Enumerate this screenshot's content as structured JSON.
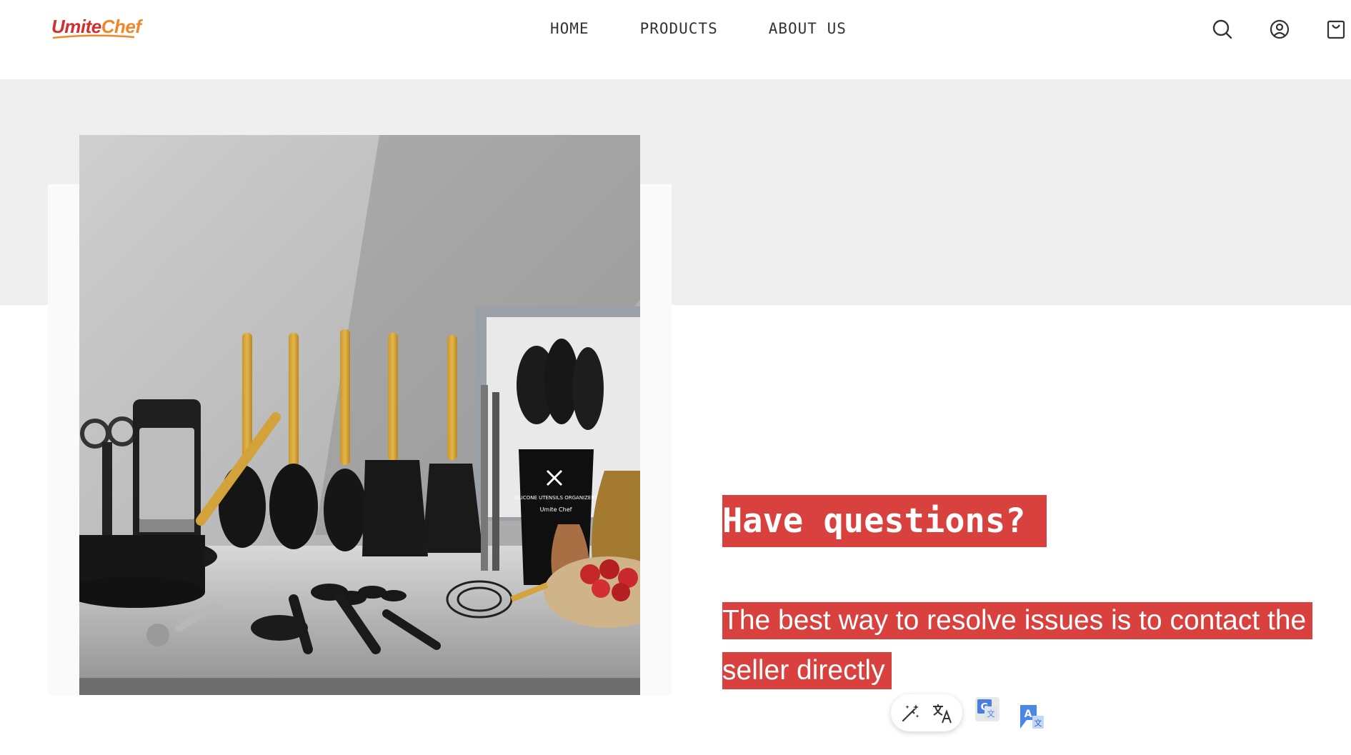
{
  "brand": {
    "logo_part1": "Umite",
    "logo_part2": "Chef"
  },
  "nav": {
    "home": "HOME",
    "products": "PRODUCTS",
    "about": "ABOUT US"
  },
  "hero": {
    "headline": "Have questions?",
    "subtext": "The best way to resolve issues is to contact the seller directly",
    "image_alt": "Black silicone kitchen utensils with wooden handles, holder labeled Silicone Utensils Organizers, grater and measuring cups on a marble countertop"
  },
  "product_label": {
    "line1": "SILICONE UTENSILS ORGANIZERS",
    "line2": "Umite Chef"
  },
  "colors": {
    "highlight": "#d9413e",
    "band": "#efefef",
    "logo_red": "#d32f2f",
    "logo_orange": "#f0882a"
  },
  "icons": [
    "search-icon",
    "account-icon",
    "cart-icon",
    "magic-wand-icon",
    "translate-icon",
    "google-translate-icon",
    "translate-a-icon"
  ]
}
